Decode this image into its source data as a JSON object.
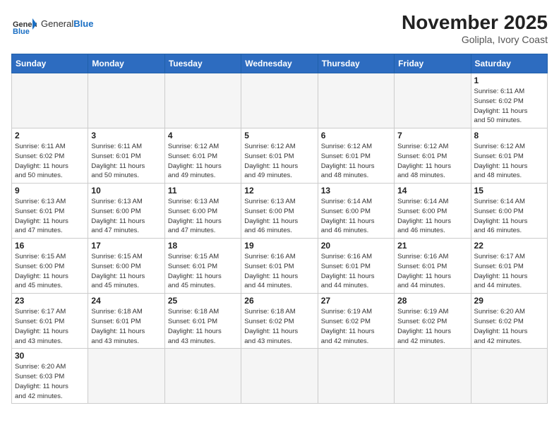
{
  "header": {
    "logo_general": "General",
    "logo_blue": "Blue",
    "month_title": "November 2025",
    "location": "Golipla, Ivory Coast"
  },
  "weekdays": [
    "Sunday",
    "Monday",
    "Tuesday",
    "Wednesday",
    "Thursday",
    "Friday",
    "Saturday"
  ],
  "weeks": [
    [
      {
        "day": "",
        "info": ""
      },
      {
        "day": "",
        "info": ""
      },
      {
        "day": "",
        "info": ""
      },
      {
        "day": "",
        "info": ""
      },
      {
        "day": "",
        "info": ""
      },
      {
        "day": "",
        "info": ""
      },
      {
        "day": "1",
        "info": "Sunrise: 6:11 AM\nSunset: 6:02 PM\nDaylight: 11 hours\nand 50 minutes."
      }
    ],
    [
      {
        "day": "2",
        "info": "Sunrise: 6:11 AM\nSunset: 6:02 PM\nDaylight: 11 hours\nand 50 minutes."
      },
      {
        "day": "3",
        "info": "Sunrise: 6:11 AM\nSunset: 6:01 PM\nDaylight: 11 hours\nand 50 minutes."
      },
      {
        "day": "4",
        "info": "Sunrise: 6:12 AM\nSunset: 6:01 PM\nDaylight: 11 hours\nand 49 minutes."
      },
      {
        "day": "5",
        "info": "Sunrise: 6:12 AM\nSunset: 6:01 PM\nDaylight: 11 hours\nand 49 minutes."
      },
      {
        "day": "6",
        "info": "Sunrise: 6:12 AM\nSunset: 6:01 PM\nDaylight: 11 hours\nand 48 minutes."
      },
      {
        "day": "7",
        "info": "Sunrise: 6:12 AM\nSunset: 6:01 PM\nDaylight: 11 hours\nand 48 minutes."
      },
      {
        "day": "8",
        "info": "Sunrise: 6:12 AM\nSunset: 6:01 PM\nDaylight: 11 hours\nand 48 minutes."
      }
    ],
    [
      {
        "day": "9",
        "info": "Sunrise: 6:13 AM\nSunset: 6:01 PM\nDaylight: 11 hours\nand 47 minutes."
      },
      {
        "day": "10",
        "info": "Sunrise: 6:13 AM\nSunset: 6:00 PM\nDaylight: 11 hours\nand 47 minutes."
      },
      {
        "day": "11",
        "info": "Sunrise: 6:13 AM\nSunset: 6:00 PM\nDaylight: 11 hours\nand 47 minutes."
      },
      {
        "day": "12",
        "info": "Sunrise: 6:13 AM\nSunset: 6:00 PM\nDaylight: 11 hours\nand 46 minutes."
      },
      {
        "day": "13",
        "info": "Sunrise: 6:14 AM\nSunset: 6:00 PM\nDaylight: 11 hours\nand 46 minutes."
      },
      {
        "day": "14",
        "info": "Sunrise: 6:14 AM\nSunset: 6:00 PM\nDaylight: 11 hours\nand 46 minutes."
      },
      {
        "day": "15",
        "info": "Sunrise: 6:14 AM\nSunset: 6:00 PM\nDaylight: 11 hours\nand 46 minutes."
      }
    ],
    [
      {
        "day": "16",
        "info": "Sunrise: 6:15 AM\nSunset: 6:00 PM\nDaylight: 11 hours\nand 45 minutes."
      },
      {
        "day": "17",
        "info": "Sunrise: 6:15 AM\nSunset: 6:00 PM\nDaylight: 11 hours\nand 45 minutes."
      },
      {
        "day": "18",
        "info": "Sunrise: 6:15 AM\nSunset: 6:01 PM\nDaylight: 11 hours\nand 45 minutes."
      },
      {
        "day": "19",
        "info": "Sunrise: 6:16 AM\nSunset: 6:01 PM\nDaylight: 11 hours\nand 44 minutes."
      },
      {
        "day": "20",
        "info": "Sunrise: 6:16 AM\nSunset: 6:01 PM\nDaylight: 11 hours\nand 44 minutes."
      },
      {
        "day": "21",
        "info": "Sunrise: 6:16 AM\nSunset: 6:01 PM\nDaylight: 11 hours\nand 44 minutes."
      },
      {
        "day": "22",
        "info": "Sunrise: 6:17 AM\nSunset: 6:01 PM\nDaylight: 11 hours\nand 44 minutes."
      }
    ],
    [
      {
        "day": "23",
        "info": "Sunrise: 6:17 AM\nSunset: 6:01 PM\nDaylight: 11 hours\nand 43 minutes."
      },
      {
        "day": "24",
        "info": "Sunrise: 6:18 AM\nSunset: 6:01 PM\nDaylight: 11 hours\nand 43 minutes."
      },
      {
        "day": "25",
        "info": "Sunrise: 6:18 AM\nSunset: 6:01 PM\nDaylight: 11 hours\nand 43 minutes."
      },
      {
        "day": "26",
        "info": "Sunrise: 6:18 AM\nSunset: 6:02 PM\nDaylight: 11 hours\nand 43 minutes."
      },
      {
        "day": "27",
        "info": "Sunrise: 6:19 AM\nSunset: 6:02 PM\nDaylight: 11 hours\nand 42 minutes."
      },
      {
        "day": "28",
        "info": "Sunrise: 6:19 AM\nSunset: 6:02 PM\nDaylight: 11 hours\nand 42 minutes."
      },
      {
        "day": "29",
        "info": "Sunrise: 6:20 AM\nSunset: 6:02 PM\nDaylight: 11 hours\nand 42 minutes."
      }
    ],
    [
      {
        "day": "30",
        "info": "Sunrise: 6:20 AM\nSunset: 6:03 PM\nDaylight: 11 hours\nand 42 minutes."
      },
      {
        "day": "",
        "info": ""
      },
      {
        "day": "",
        "info": ""
      },
      {
        "day": "",
        "info": ""
      },
      {
        "day": "",
        "info": ""
      },
      {
        "day": "",
        "info": ""
      },
      {
        "day": "",
        "info": ""
      }
    ]
  ]
}
